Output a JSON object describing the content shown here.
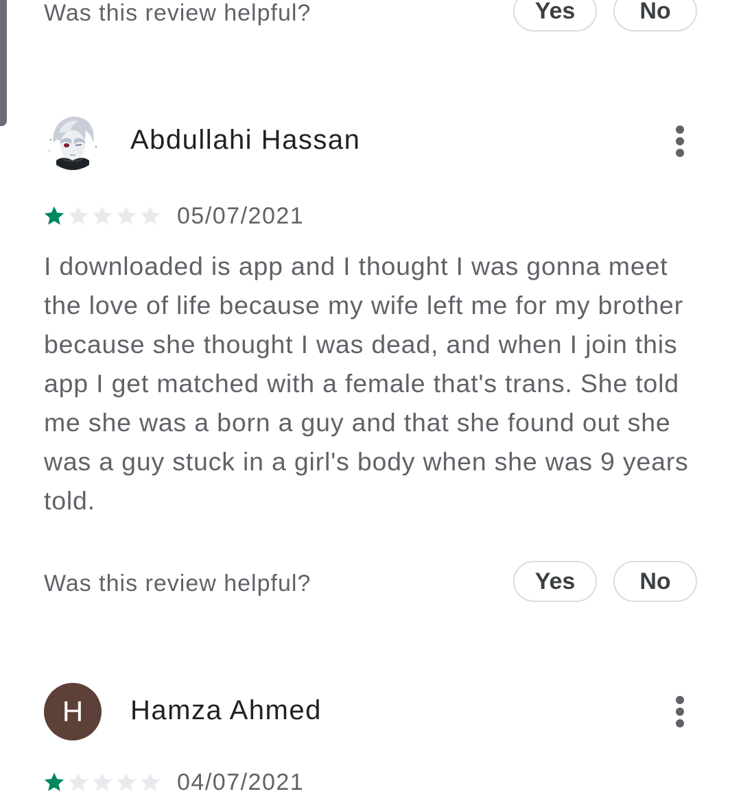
{
  "prev_review": {
    "helpful": {
      "question": "Was this review helpful?",
      "yes_label": "Yes",
      "no_label": "No"
    }
  },
  "reviews": [
    {
      "name": "Abdullahi Hassan",
      "avatar": "anime-character-avatar",
      "rating": 1,
      "max_rating": 5,
      "date": "05/07/2021",
      "text": "I downloaded is app and I thought I was gonna meet the love of life because my wife left me for my brother because she thought I was dead, and when I join this app I get matched with a female that's trans. She told me she was a born a guy and that she found out she was a guy stuck in a girl's body when she was 9 years told.",
      "helpful": {
        "question": "Was this review helpful?",
        "yes_label": "Yes",
        "no_label": "No"
      }
    },
    {
      "name": "Hamza Ahmed",
      "avatar_letter": "H",
      "avatar_color": "#5d4037",
      "rating": 1,
      "max_rating": 5,
      "date": "04/07/2021"
    }
  ],
  "colors": {
    "star_filled": "#01875f",
    "star_empty": "#e8eaed",
    "text_primary": "#202124",
    "text_secondary": "#5f6368",
    "pill_border": "#dadce0"
  },
  "icons": {
    "more": "more-vert-icon",
    "star": "star-icon"
  }
}
